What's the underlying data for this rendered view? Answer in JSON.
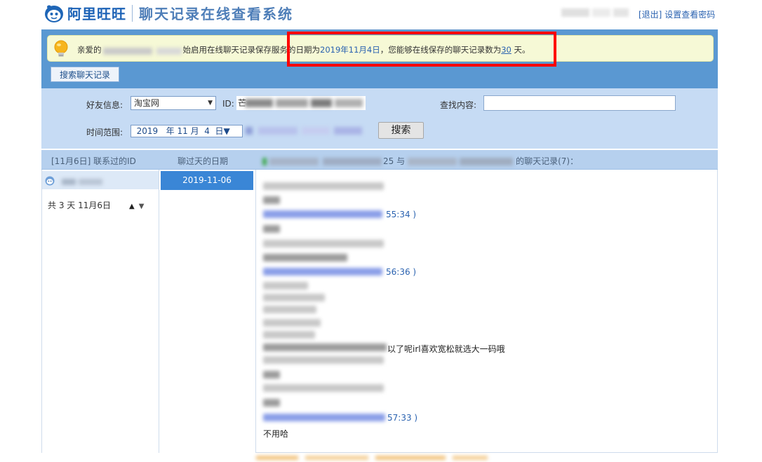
{
  "header": {
    "logo_text": "阿里旺旺",
    "system_title": "聊天记录在线查看系统",
    "logout_link": "[退出]",
    "settings_link": "设置查看密码"
  },
  "notice": {
    "prefix": "亲爱的",
    "mid": "始启用在线聊天记录保存服务的日期为",
    "start_date": "2019年11月4日",
    "mid2": "，您能够在线保存的聊天记录数为",
    "count": "30",
    "suffix": "天。"
  },
  "search_tab": "搜索聊天记录",
  "search": {
    "friend_label": "好友信息:",
    "friend_select": "淘宝网",
    "id_label": "ID:",
    "id_prefix": "芒",
    "find_label": "查找内容:",
    "time_label": "时间范围:",
    "date": {
      "year": "2019",
      "year_unit": "年",
      "month": "11",
      "month_unit": "月",
      "day": "4",
      "day_unit": "日"
    },
    "search_button": "搜索"
  },
  "columns": {
    "contacted_ids": "[11月6日] 联系过的ID",
    "chat_dates": "聊过天的日期",
    "record_mid": "25 与",
    "record_suffix": "的聊天记录(7)："
  },
  "left_panel": {
    "pager_text": "共 3 天 11月6日",
    "up_glyph": "▲",
    "down_glyph": "▼"
  },
  "dates": [
    "2019-11-06"
  ],
  "messages": {
    "time1_tail": "55:34 )",
    "time2_tail": "56:36 )",
    "text_line": "以了呢irl喜欢宽松就选大一码哦",
    "time3_tail": "57:33 )",
    "last_text": "不用哈"
  }
}
